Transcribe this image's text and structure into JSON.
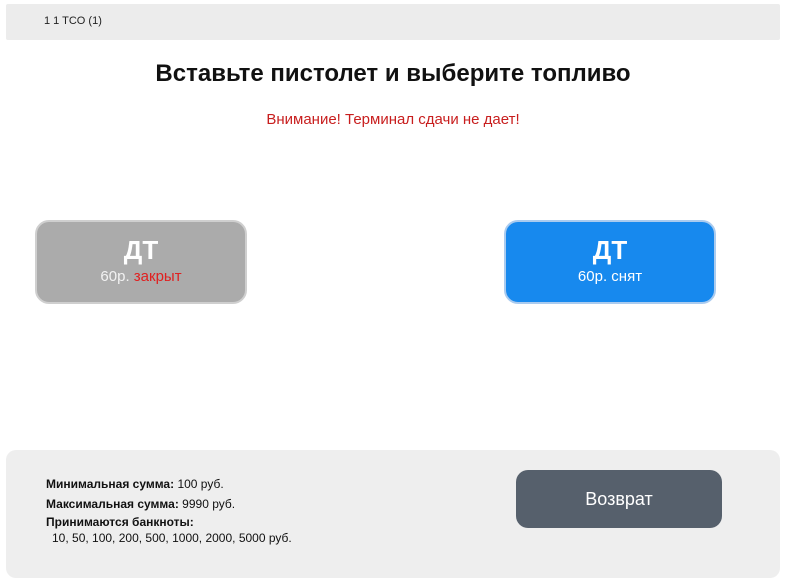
{
  "header": {
    "breadcrumb": "1  1  TCO (1)"
  },
  "title": "Вставьте пистолет и выберите топливо",
  "warning": "Внимание! Терминал сдачи не дает!",
  "fuels": [
    {
      "name": "ДТ",
      "price": "60р.",
      "status": "закрыт",
      "state": "closed"
    },
    {
      "name": "ДТ",
      "price": "60р.",
      "status": "снят",
      "state": "active"
    }
  ],
  "limits": {
    "min_label": "Минимальная сумма:",
    "min_value": "100 руб.",
    "max_label": "Максимальная сумма:",
    "max_value": "9990 руб.",
    "notes_label": "Принимаются банкноты:",
    "notes_value": "10, 50, 100, 200, 500, 1000, 2000, 5000 руб."
  },
  "return_button": "Возврат",
  "colors": {
    "warning": "#c81e1e",
    "active_button": "#1789ee",
    "closed_button": "#ababab",
    "return_button": "#56606c"
  }
}
